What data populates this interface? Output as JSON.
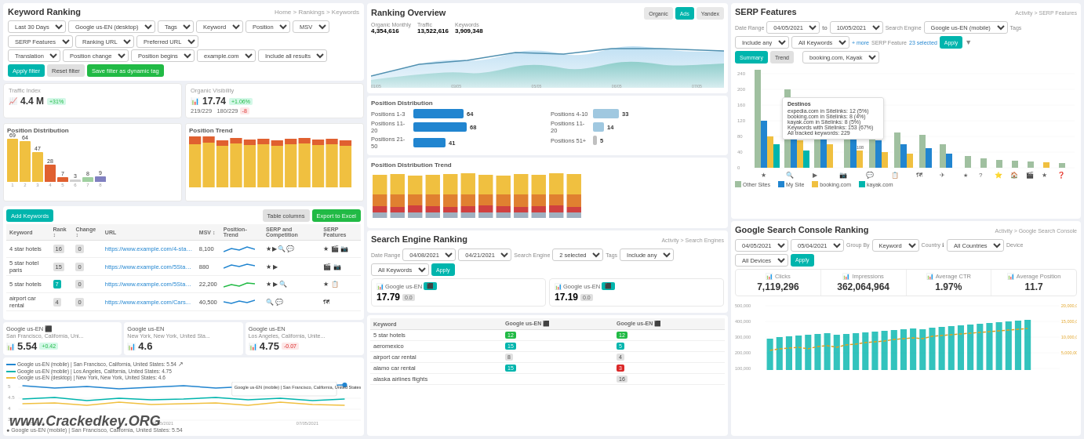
{
  "app": {
    "title": "Keyword Ranking"
  },
  "left": {
    "title": "Keyword Ranking",
    "breadcrumb": "Home > Rankings > Keywords",
    "filters": {
      "date_range": "Last 30 Days",
      "engine": "Google us-EN (desktop)",
      "tags_label": "Tags",
      "keyword_label": "Keyword",
      "position_label": "Position",
      "msv_label": "MSV",
      "serp_label": "SERP Features",
      "ranking_url_label": "Ranking URL",
      "preferred_url_label": "Preferred URL",
      "translation_label": "Translation",
      "position_change_label": "Position change",
      "position_begins_label": "Position begins",
      "example_domain": "example.com",
      "include_all": "Include all results",
      "btn_apply": "Apply filter",
      "btn_reset": "Reset filter",
      "btn_save": "Save filter as dynamic tag"
    },
    "metrics": {
      "traffic_index_label": "Traffic Index",
      "traffic_value": "4.4 M",
      "traffic_badge": "+31%",
      "organic_label": "Organic Visibility",
      "organic_trend_value": "17.74",
      "organic_badge": "+1.06%",
      "organic_current": "219",
      "organic_total": "229",
      "organic2_current": "180",
      "organic2_total": "229"
    },
    "position_distribution": {
      "title": "Position Distribution",
      "bars": [
        {
          "label": "1",
          "value": 69,
          "color": "#f0c040"
        },
        {
          "label": "2",
          "value": 64,
          "color": "#f0c040"
        },
        {
          "label": "3",
          "value": 47,
          "color": "#f0c040"
        },
        {
          "label": "4",
          "value": 28,
          "color": "#e06030"
        },
        {
          "label": "5",
          "value": 7,
          "color": "#e06030"
        },
        {
          "label": "6",
          "value": 3,
          "color": "#d0d0d0"
        },
        {
          "label": "7",
          "value": 8,
          "color": "#a0c0a0"
        },
        {
          "label": "8",
          "value": 9,
          "color": "#8080c0"
        }
      ]
    },
    "position_trend": {
      "title": "Position Trend"
    },
    "table": {
      "add_keywords": "Add Keywords",
      "table_columns": "Table columns",
      "export": "Export to Excel",
      "headers": [
        "Keyword",
        "Rank",
        "Change",
        "URL",
        "MSV",
        "Position-Trend",
        "SERP and Competition",
        "SERP Features"
      ],
      "rows": [
        {
          "keyword": "4 star hotels",
          "rank": "16",
          "change": "0",
          "url": "https://www.example.com/4-star-hot...",
          "msv": "8,100",
          "badge_color": "gray"
        },
        {
          "keyword": "5 star hotel paris",
          "rank": "15",
          "change": "0",
          "url": "https://www.example.com/5Star-Paris-Hotels...",
          "msv": "880",
          "badge_color": "gray"
        },
        {
          "keyword": "5 star hotels",
          "rank": "7",
          "change": "0",
          "url": "https://www.example.com/5Star-Los-Angele...",
          "msv": "22,200",
          "badge_color": "teal"
        },
        {
          "keyword": "airport car rental",
          "rank": "4",
          "change": "0",
          "url": "https://www.example.com/Cars...",
          "msv": "40,500",
          "badge_color": "gray"
        }
      ]
    },
    "geo_cards": [
      {
        "engine": "Google us-EN",
        "location": "San Francisco, California, Uni...",
        "value": "5.54",
        "badge": "+0.42",
        "badge_type": "green"
      },
      {
        "engine": "Google us-EN",
        "location": "New York, New York, United Sta...",
        "value": "4.6",
        "badge": "",
        "badge_type": ""
      },
      {
        "engine": "Google us-EN",
        "location": "Los Angeles, California, Unite...",
        "value": "4.75",
        "badge": "-0.07",
        "badge_type": "red"
      }
    ],
    "chart_legend": [
      {
        "label": "Google us-EN (mobile) | San Francisco, California, United States: 5.54",
        "color": "#2185d0"
      },
      {
        "label": "Google us-EN (mobile) | Los Angeles, California, United States: 4.75",
        "color": "#00b5ad"
      },
      {
        "label": "Google us-EN (desktop) | New York, New York, United States: 4.6",
        "color": "#f0c040"
      }
    ],
    "watermark": "www.Crackedkey.ORG"
  },
  "middle": {
    "title": "Ranking Overview",
    "tabs": [
      "Organic",
      "Google Ads",
      "Yandex"
    ],
    "active_tab": "Ads",
    "metrics": {
      "organic_monthly": "4,354,616",
      "organic_monthly_label": "Organic Monthly",
      "traffic_label": "Traffic",
      "traffic_value": "13,522,616",
      "keywords_label": "Keywords",
      "keywords_value": "3,909,348"
    },
    "position_distribution": {
      "title": "Position Distribution",
      "rows": [
        {
          "label": "Positions 1-3",
          "value": 64,
          "max": 100
        },
        {
          "label": "Positions 4-10",
          "value": 33,
          "max": 100
        },
        {
          "label": "Positions 11-20",
          "value": 68,
          "max": 100
        },
        {
          "label": "Positions 11-20b",
          "value": 14,
          "max": 100
        },
        {
          "label": "Positions 21-50",
          "value": 41,
          "max": 100
        },
        {
          "label": "Positions 51+",
          "value": 5,
          "max": 100
        }
      ]
    },
    "pos_dist_trend_title": "Position Distribution Trend",
    "search_engine_title": "Search Engine Ranking",
    "search_engine_filters": {
      "date_range_label": "Date Range",
      "date_from": "04/08/2021",
      "date_to": "04/21/2021",
      "search_engine_label": "Search Engine",
      "engine_value": "2 selected",
      "tags_label": "Tags",
      "tags_value": "Include any",
      "keywords_label": "All Keywords",
      "btn_apply": "Apply"
    },
    "engine_cards": [
      {
        "engine": "Google us-EN",
        "value": "17.79",
        "badge": "0.0",
        "badge_type": "gray"
      },
      {
        "engine": "Google us-EN",
        "value": "17.19",
        "badge": "0.0",
        "badge_type": "gray"
      }
    ],
    "keyword_table": {
      "headers": [
        "Keyword",
        "Google us-EN",
        "Google us-EN"
      ],
      "rows": [
        {
          "keyword": "5 star hotels",
          "v1": "12",
          "v1_badge": "green",
          "v2": "12",
          "v2_badge": "green"
        },
        {
          "keyword": "aeromexico",
          "v1": "15",
          "v1_badge": "teal",
          "v2": "5",
          "v2_badge": "teal"
        },
        {
          "keyword": "airport car rental",
          "v1": "8",
          "v1_badge": "gray",
          "v2": "4",
          "v2_badge": "gray"
        },
        {
          "keyword": "alamo car rental",
          "v1": "15",
          "v1_badge": "teal",
          "v2": "3",
          "v2_badge": "red"
        },
        {
          "keyword": "alaska airlines flights",
          "v1": "",
          "v1_badge": "",
          "v2": "16",
          "v2_badge": "gray"
        }
      ]
    }
  },
  "right": {
    "serp_title": "SERP Features",
    "serp_filters": {
      "date_range_label": "Date Range",
      "date_from": "04/05/2021",
      "date_to": "10/05/2021",
      "search_engine_label": "Search Engine",
      "engine_value": "Google us-EN (mobile)",
      "tags_label": "Tags",
      "tags_value": "Include any",
      "keywords_label": "All Keywords",
      "more_label": "+ more",
      "serp_features_label": "SERP Feature",
      "selected_count": "23 selected",
      "btn_apply": "Apply"
    },
    "serp_tabs": [
      "Summary",
      "Trend"
    ],
    "serp_active_tab": "Summary",
    "serp_comparison": "booking.com, Kayak",
    "serp_tooltip": {
      "title": "Destinos",
      "line1": "expedia.com in Sitelinks: 12 (5%)",
      "line2": "booking.com in Sitelinks: 8 (4%)",
      "line3": "kayak.com in Sitelinks: 8 (5%)",
      "line4": "Keywords with Sitelinks: 153 (67%)",
      "line5": "All tracked keywords: 229"
    },
    "serp_legend": [
      "Other Sites",
      "My Site",
      "booking.com",
      "kayak.com"
    ],
    "serp_colors": [
      "#a0c0a0",
      "#2185d0",
      "#f0c040",
      "#00b5ad"
    ],
    "serp_icons": [
      "★",
      "🔍",
      "▶",
      "📷",
      "💬",
      "📋",
      "🗺",
      "✈",
      "★",
      "?",
      "⭐",
      "🏠",
      "🎬"
    ],
    "console_title": "Google Search Console Ranking",
    "console_filters": {
      "date_from": "04/05/2021",
      "date_to": "05/04/2021",
      "group_by": "Keyword",
      "country": "All Countries",
      "device": "All Devices",
      "btn_apply": "Apply"
    },
    "console_metrics": [
      {
        "label": "Clicks",
        "value": "7,119,296"
      },
      {
        "label": "Impressions",
        "value": "362,064,964"
      },
      {
        "label": "Average CTR",
        "value": "1.97%"
      },
      {
        "label": "Average Position",
        "value": "11.7"
      }
    ]
  }
}
